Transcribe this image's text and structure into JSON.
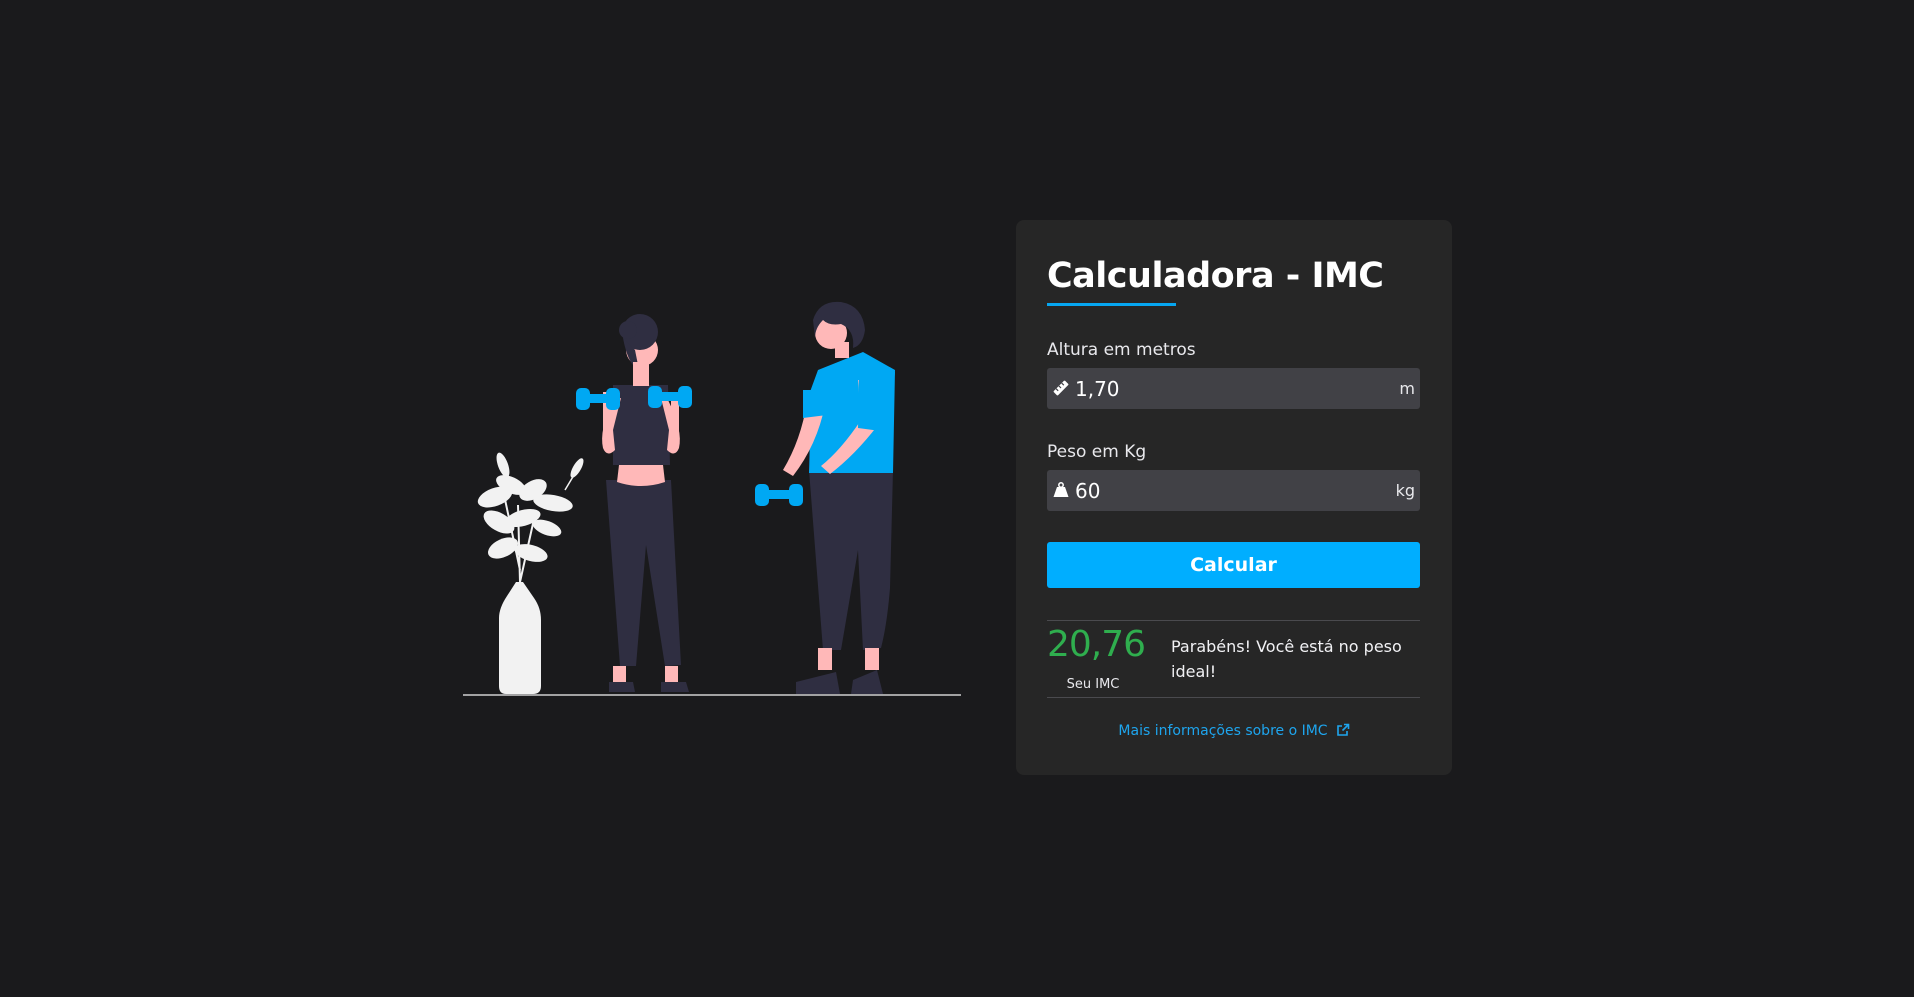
{
  "app": {
    "title": "Calculadora - IMC"
  },
  "form": {
    "height": {
      "label": "Altura em metros",
      "value": "1,70",
      "unit": "m",
      "icon": "ruler-icon"
    },
    "weight": {
      "label": "Peso em Kg",
      "value": "60",
      "unit": "kg",
      "icon": "weight-icon"
    },
    "submit_label": "Calcular"
  },
  "result": {
    "value": "20,76",
    "caption": "Seu IMC",
    "message": "Parabéns! Você está no peso ideal!"
  },
  "more_info": {
    "label": "Mais informações sobre o IMC",
    "icon": "external-link-icon"
  },
  "colors": {
    "background": "#1a1a1c",
    "card": "#262626",
    "accent": "#00aeff",
    "success": "#2fae4e",
    "link": "#1ea5ee"
  }
}
